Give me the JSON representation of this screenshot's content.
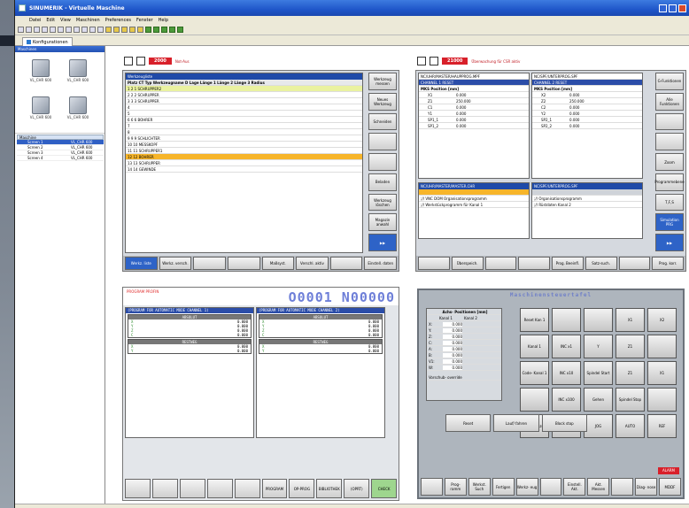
{
  "window": {
    "title": "SINUMERIK - Virtuelle Maschine"
  },
  "menubar": [
    "Datei",
    "Edit",
    "View",
    "Maschinen",
    "Preferences",
    "Fenster",
    "Help"
  ],
  "tab": {
    "label": "Konfigurationen"
  },
  "left": {
    "machines_header": "Maschinen",
    "machines": [
      {
        "name": "VL_CHR 600"
      },
      {
        "name": "VL_CHR 600"
      },
      {
        "name": "VL_CHR 600"
      },
      {
        "name": "VL_CHR 600"
      }
    ],
    "table_header": "Maschine",
    "rows": [
      {
        "name": "Screen 1",
        "val": "VL_CHR 600"
      },
      {
        "name": "Screen 2",
        "val": "VL_CHR 600"
      },
      {
        "name": "Screen 3",
        "val": "VL_CHR 600"
      },
      {
        "name": "Screen 4",
        "val": "VL_CHR 600"
      }
    ]
  },
  "p1": {
    "alarm_code": "2000",
    "alarm_text": "Not-Aus",
    "header": "Werkzeugliste",
    "col_head": "Platz  CT  Typ   Werkzeugname   D  Lage  Länge 1  Länge 2  Länge 3  Radius",
    "rows": [
      {
        "t": "1   2   1  SCHRUPPER2",
        "s": "hl"
      },
      {
        "t": "2   2   2  SCHRUPPER",
        "s": ""
      },
      {
        "t": "3   3   3  SCHRUPPER",
        "s": ""
      },
      {
        "t": "4",
        "s": ""
      },
      {
        "t": "5",
        "s": ""
      },
      {
        "t": "6   6   6  BOHRER",
        "s": ""
      },
      {
        "t": "7",
        "s": ""
      },
      {
        "t": "8",
        "s": ""
      },
      {
        "t": "9   9   9  SCHLICHTER",
        "s": ""
      },
      {
        "t": "10  10  MESSKOPF",
        "s": ""
      },
      {
        "t": "11  11  SCHRUPPER1",
        "s": ""
      },
      {
        "t": "12  12  BOHRER",
        "s": "sel"
      },
      {
        "t": "13  13  SCHRUPPER",
        "s": ""
      },
      {
        "t": "14  14  GEWINDE",
        "s": ""
      }
    ],
    "right_keys": [
      "Werkzeug messen",
      "Neues Werkzeug",
      "Schneiden",
      "",
      "",
      "Beladen",
      "Werkzeug löschen",
      "Magazin anwahl",
      ""
    ],
    "bottom_keys": [
      "Werkz. liste",
      "Werkz. versch.",
      "",
      "",
      "Maßsyst.",
      "Verschl. aktiv",
      "",
      "Einstell. daten"
    ]
  },
  "p2": {
    "alarm_code": "21000",
    "alarm_text": "Überwachung für CSR aktiv",
    "left_path": "NC/UHR/MASTER/HAUPPROG.MPF",
    "right_path": "NC/SPF/UNTERPROG.SPF",
    "left_sub": "CHANNEL 1  RESET",
    "right_sub": "CHANNEL 2  RESET",
    "pos_head": "MKS   Position [mm]",
    "left_axes": [
      [
        "X1",
        "0.000"
      ],
      [
        "Z1",
        "250.000"
      ],
      [
        "C1",
        "0.000"
      ],
      [
        "Y1",
        "0.000"
      ],
      [
        "SP1_1",
        "0.000"
      ],
      [
        "SP1_2",
        "0.000"
      ]
    ],
    "right_axes": [
      [
        "X2",
        "0.000"
      ],
      [
        "Z2",
        "250.000"
      ],
      [
        "C2",
        "0.000"
      ],
      [
        "Y2",
        "0.000"
      ],
      [
        "SP2_1",
        "0.000"
      ],
      [
        "SP2_2",
        "0.000"
      ]
    ],
    "prog_left": "NC/UHR/MASTER/MASTER.CHR",
    "prog_right": "NC/SPF/UNTERPROG.SPF",
    "prog_left_line": ";// VNC DOM Organisationsprogramm",
    "prog_left_line2": ";// Werkstückprogramm für Kanal 1",
    "prog_right_line": ";// Organisationsprogramm",
    "prog_right_line2": ";// Rüstdaten Kanal 2",
    "right_keys": [
      "G-Funktionen",
      "Alle Funktionen",
      "",
      "",
      "Zoom",
      "Programmebene",
      "T,F,S",
      "Simulation PRG",
      ""
    ],
    "bottom_keys": [
      "",
      "Überspeich.",
      "",
      "",
      "Prog. Beeinfl.",
      "Satz-such.",
      "",
      "Prog. korr."
    ]
  },
  "p3": {
    "prog": "PROGRAM PROFIN",
    "big_number": "O0001 N00000",
    "left_title": "(PROGRAM FOR AUTOMATIC MODE CHANNEL 1)",
    "right_title": "(PROGRAM FOR AUTOMATIC MODE CHANNEL 2)",
    "abs_label": "ABSOLUT",
    "rest_label": "RESTWEG",
    "axes": [
      [
        "X",
        "0.000"
      ],
      [
        "Y",
        "0.000"
      ],
      [
        "Z",
        "0.000"
      ],
      [
        "C",
        "0.000"
      ]
    ],
    "bottom_keys": [
      "",
      "",
      "",
      "",
      "",
      "PROGRAM",
      "OP-PROG",
      "BIBLIOTHEK",
      "(OPRT)",
      "CHECK"
    ]
  },
  "p4": {
    "title": "Maschinensteuertafel",
    "tbl_head": "Achs- Positionen [mm]",
    "col1": "Kanal 1",
    "col2": "Kanal 2",
    "rows": [
      [
        "X:",
        "0.000"
      ],
      [
        "Y:",
        "0.000"
      ],
      [
        "Z:",
        "0.000"
      ],
      [
        "C:",
        "0.000"
      ],
      [
        "A:",
        "0.000"
      ],
      [
        "B:",
        "0.000"
      ],
      [
        "V1:",
        "0.000"
      ],
      [
        "W:",
        "0.000"
      ]
    ],
    "feed": "Vorschub- override",
    "buttons": [
      "Reset Kan 1",
      "",
      "",
      "X1",
      "X2",
      "Kanal 1",
      "INC x1",
      "Y",
      "Z1",
      "",
      "Code- Kanal 1",
      "INC x10",
      "Spindel Start",
      "Z1",
      "X1",
      "",
      "INC x100",
      "Gehen",
      "Spindel Stop",
      "",
      "Satz/ Einzel",
      "MDA",
      "JOG",
      "AUTO",
      "REF"
    ],
    "mid_keys": [
      "Reset",
      "Lauf/ fahren",
      "Block stop"
    ],
    "bottom_keys": [
      "",
      "Prog- ramm",
      "Werkst. Such",
      "Fertigen",
      "Werkz- eug",
      "",
      "Einstell. Akt.",
      "Akt. Messen",
      "",
      "Diag- nose",
      "MDDF"
    ],
    "status": "ALARM"
  }
}
